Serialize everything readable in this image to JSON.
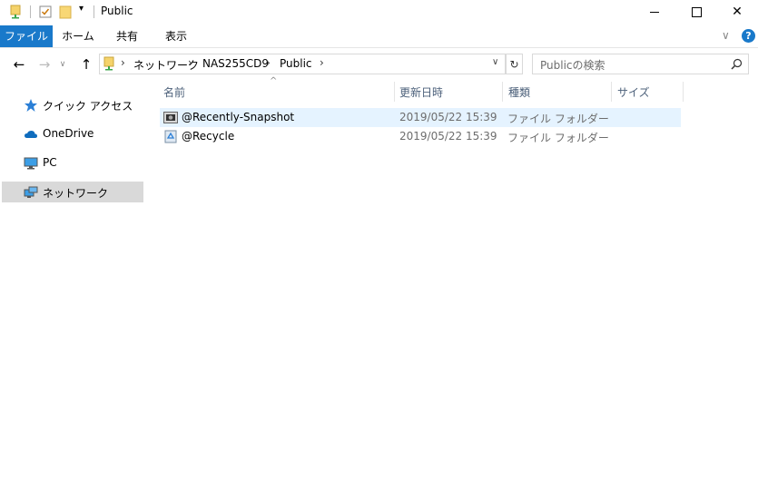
{
  "window": {
    "title": "Public"
  },
  "ribbon": {
    "tabs": [
      {
        "label": "ファイル"
      },
      {
        "label": "ホーム"
      },
      {
        "label": "共有"
      },
      {
        "label": "表示"
      }
    ]
  },
  "address": {
    "segments": [
      "ネットワーク",
      "NAS255CD9",
      "Public"
    ]
  },
  "search": {
    "placeholder": "Publicの検索"
  },
  "nav": {
    "items": [
      {
        "label": "クイック アクセス"
      },
      {
        "label": "OneDrive"
      },
      {
        "label": "PC"
      },
      {
        "label": "ネットワーク"
      }
    ]
  },
  "columns": {
    "name": "名前",
    "date": "更新日時",
    "type": "種類",
    "size": "サイズ"
  },
  "files": [
    {
      "name": "@Recently-Snapshot",
      "date": "2019/05/22 15:39",
      "type": "ファイル フォルダー"
    },
    {
      "name": "@Recycle",
      "date": "2019/05/22 15:39",
      "type": "ファイル フォルダー"
    }
  ],
  "colors": {
    "accent": "#1979ca",
    "selection": "#e5f3ff",
    "nav_selected": "#d9d9d9",
    "header_text": "#4c607a"
  }
}
